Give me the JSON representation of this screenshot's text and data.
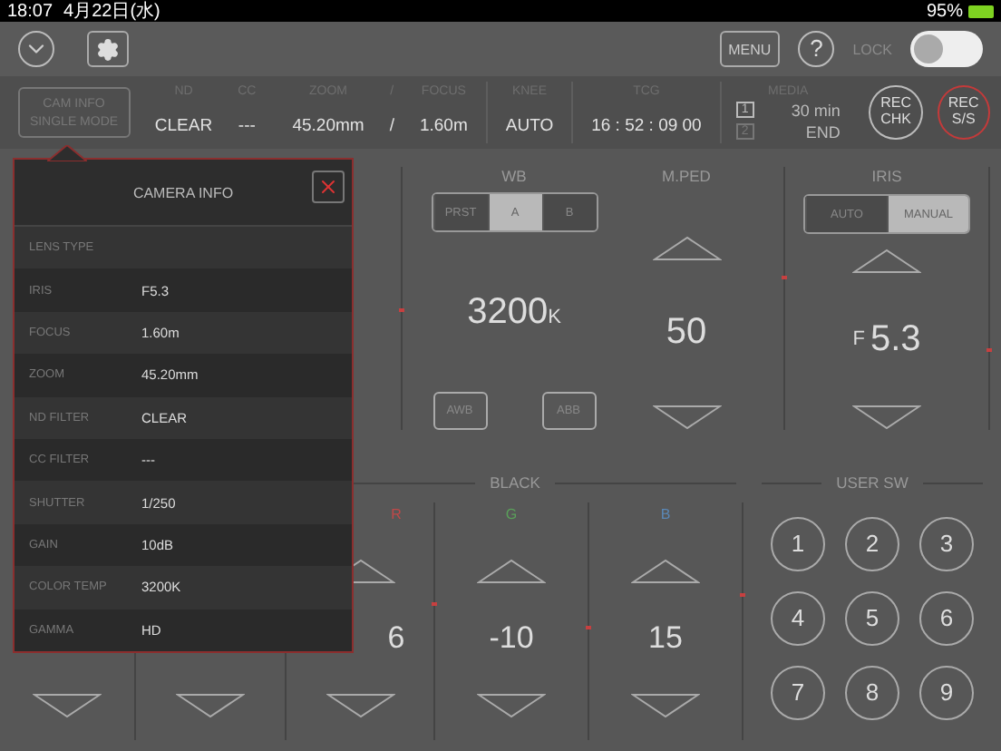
{
  "status_bar": {
    "time": "18:07",
    "date": "4月22日(水)",
    "battery": "95%"
  },
  "toolbar": {
    "menu": "MENU",
    "help": "?",
    "lock": {
      "label": "LOCK",
      "on": false
    }
  },
  "info_bar": {
    "mode_button": {
      "line_1": "CAM INFO",
      "line_2": "SINGLE MODE"
    },
    "groups": [
      {
        "fields": [
          {
            "label": "ND",
            "value": "CLEAR"
          },
          {
            "label": "CC",
            "value": "---"
          }
        ]
      },
      {
        "fields": [
          {
            "label": "ZOOM",
            "value": "45.20mm"
          },
          {
            "label": "FOCUS",
            "value": "1.60m"
          }
        ],
        "label_separator": "/",
        "value_separator": "/"
      },
      {
        "fields": [
          {
            "label": "KNEE",
            "value": "AUTO"
          }
        ]
      },
      {
        "fields": [
          {
            "label": "TCG",
            "value": "16 : 52 : 09  00"
          }
        ]
      }
    ],
    "media": {
      "label": "MEDIA",
      "slots": [
        {
          "slot": "1",
          "value": "30 min",
          "active": true
        },
        {
          "slot": "2",
          "value": "END",
          "active": false
        }
      ]
    },
    "rec_buttons": [
      {
        "line_1": "REC",
        "line_2": "CHK",
        "kind": "check"
      },
      {
        "line_1": "REC",
        "line_2": "S/S",
        "kind": "record"
      }
    ]
  },
  "wb": {
    "title": "WB",
    "modes": [
      {
        "label": "PRST",
        "selected": false
      },
      {
        "label": "A",
        "selected": true
      },
      {
        "label": "B",
        "selected": false
      }
    ],
    "value": "3200",
    "unit": "K",
    "buttons": [
      "AWB",
      "ABB"
    ]
  },
  "m_ped": {
    "title": "M.PED",
    "value": "50"
  },
  "iris": {
    "title": "IRIS",
    "modes": [
      {
        "label": "AUTO",
        "selected": false
      },
      {
        "label": "MANUAL",
        "selected": true
      }
    ],
    "prefix": "F",
    "value": "5.3"
  },
  "black": {
    "title": "BLACK",
    "channels": [
      {
        "label": "R",
        "color": "#c04848",
        "value": "6"
      },
      {
        "label": "G",
        "color": "#5aa05a",
        "value": "-10"
      },
      {
        "label": "B",
        "color": "#5a88b8",
        "value": "15"
      }
    ]
  },
  "user_sw": {
    "title": "USER SW",
    "buttons": [
      "1",
      "2",
      "3",
      "4",
      "5",
      "6",
      "7",
      "8",
      "9"
    ]
  },
  "camera_info": {
    "title": "CAMERA INFO",
    "rows": [
      {
        "label": "LENS TYPE"
      },
      {
        "label": "IRIS",
        "value": "F5.3"
      },
      {
        "label": "FOCUS",
        "value": "1.60m"
      },
      {
        "label": "ZOOM",
        "value": "45.20mm"
      },
      {
        "label": "ND FILTER",
        "value": "CLEAR"
      },
      {
        "label": "CC FILTER",
        "value": "---"
      },
      {
        "label": "SHUTTER",
        "value": "1/250"
      },
      {
        "label": "GAIN",
        "value": "10dB"
      },
      {
        "label": "COLOR TEMP",
        "value": "3200K"
      },
      {
        "label": "GAMMA",
        "value": "HD"
      }
    ]
  }
}
